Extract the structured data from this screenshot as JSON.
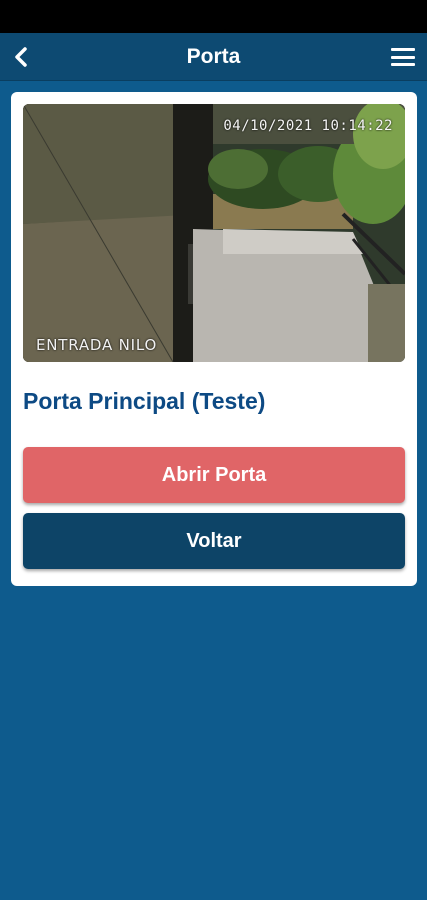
{
  "header": {
    "title": "Porta",
    "back_icon": "chevron-left-icon",
    "menu_icon": "hamburger-menu-icon"
  },
  "camera": {
    "timestamp": "04/10/2021 10:14:22",
    "label": "ENTRADA NILO"
  },
  "door": {
    "name": "Porta Principal (Teste)"
  },
  "actions": {
    "open_label": "Abrir Porta",
    "back_label": "Voltar"
  },
  "colors": {
    "background": "#0e5b8d",
    "app_bar": "#0d4a72",
    "open_button": "#e06567",
    "back_button": "#0d4467",
    "door_name": "#0d4a84"
  }
}
